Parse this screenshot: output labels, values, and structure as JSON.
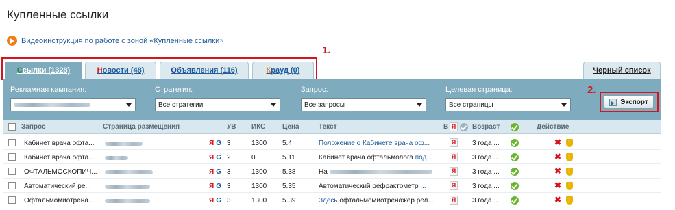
{
  "page": {
    "title": "Купленные ссылки",
    "video_link": "Видеоинструкция по работе с зоной «Купленные ссылки»"
  },
  "callouts": {
    "one": "1.",
    "two": "2."
  },
  "tabs": [
    {
      "first": "С",
      "rest": "сылки (1328)",
      "first_color": "#1f8a3b"
    },
    {
      "first": "Н",
      "rest": "овости (48)",
      "first_color": "#d6141d"
    },
    {
      "first": "О",
      "rest": "бъявления (116)",
      "first_color": "#1f3f9a"
    },
    {
      "first": "К",
      "rest": "рауд (0)",
      "first_color": "#ef7d1a"
    }
  ],
  "blacklist_tab": {
    "first": "Ч",
    "rest": "ерный список"
  },
  "filters": {
    "campaign_label": "Рекламная кампания:",
    "strategy_label": "Стратегия:",
    "strategy_value": "Все стратегии",
    "query_label": "Запрос:",
    "query_value": "Все запросы",
    "target_label": "Целевая страница:",
    "target_value": "Все страницы"
  },
  "export_label": "Экспорт",
  "table": {
    "headers": {
      "query": "Запрос",
      "page": "Страница размещения",
      "uv": "УВ",
      "iks": "ИКС",
      "price": "Цена",
      "text": "Текст",
      "index": "В",
      "age": "Возраст",
      "action": "Действие"
    },
    "rows": [
      {
        "query": "Кабинет врача офта...",
        "ya": "Я",
        "g": "G",
        "uv": "3",
        "iks": "1300",
        "price": "5.4",
        "text_pre": "",
        "text_link": "Положение о Кабинете врача оф...",
        "text_post": "",
        "age": "3 года ..."
      },
      {
        "query": "Кабинет врача офта...",
        "ya": "Я",
        "g": "G",
        "uv": "2",
        "iks": "0",
        "price": "5.11",
        "text_pre": "Кабинет врача офтальмолога ",
        "text_link": "под...",
        "text_post": "",
        "age": "3 года ..."
      },
      {
        "query": "ОФТАЛЬМОСКОПИЧ...",
        "ya": "Я",
        "g": "G",
        "uv": "3",
        "iks": "1300",
        "price": "5.38",
        "text_pre": "На ",
        "text_link": "",
        "text_post": "",
        "age": "3 года ..."
      },
      {
        "query": "Автоматический ре...",
        "ya": "Я",
        "g": "G",
        "uv": "3",
        "iks": "1300",
        "price": "5.35",
        "text_pre": "Автоматический рефрактометр ",
        "text_link": "...",
        "text_post": "",
        "age": "3 года ..."
      },
      {
        "query": "Офтальмомиотрена...",
        "ya": "Я",
        "g": "G",
        "uv": "3",
        "iks": "1300",
        "price": "5.39",
        "text_pre": "",
        "text_link": "Здесь",
        "text_post": " офтальмомиотренажер рел...",
        "age": "3 года ..."
      }
    ]
  }
}
